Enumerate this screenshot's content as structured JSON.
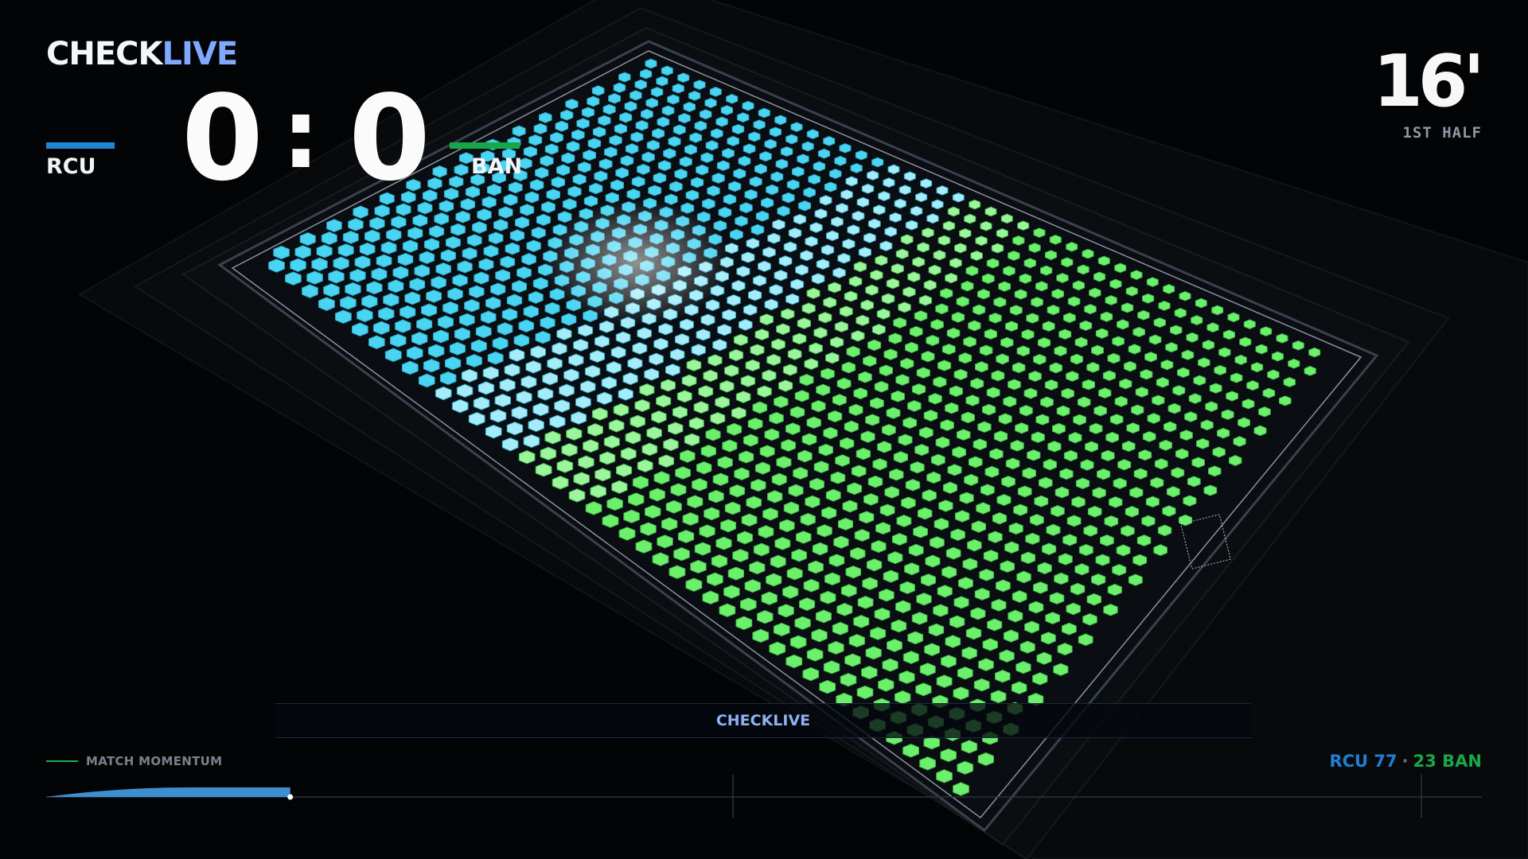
{
  "brand": {
    "part1": "CHECK",
    "part2": "LIVE"
  },
  "home": {
    "name": "RCU",
    "score": "0",
    "color": "#1f86d6"
  },
  "away": {
    "name": "BAN",
    "score": "0",
    "color": "#17a649"
  },
  "score_separator": ":",
  "clock": {
    "minute": "16'",
    "period": "1ST HALF"
  },
  "banner": {
    "text": "CHECKLIVE"
  },
  "momentum": {
    "label": "MATCH MOMENTUM",
    "progress": 0.17
  },
  "possession": {
    "home_label": "RCU 77",
    "separator": "·",
    "away_label": "23 BAN",
    "home": 77,
    "away": 23
  },
  "colors": {
    "home_tile": "#49d4f2",
    "away_tile": "#6cf06c",
    "background": "#030405"
  }
}
